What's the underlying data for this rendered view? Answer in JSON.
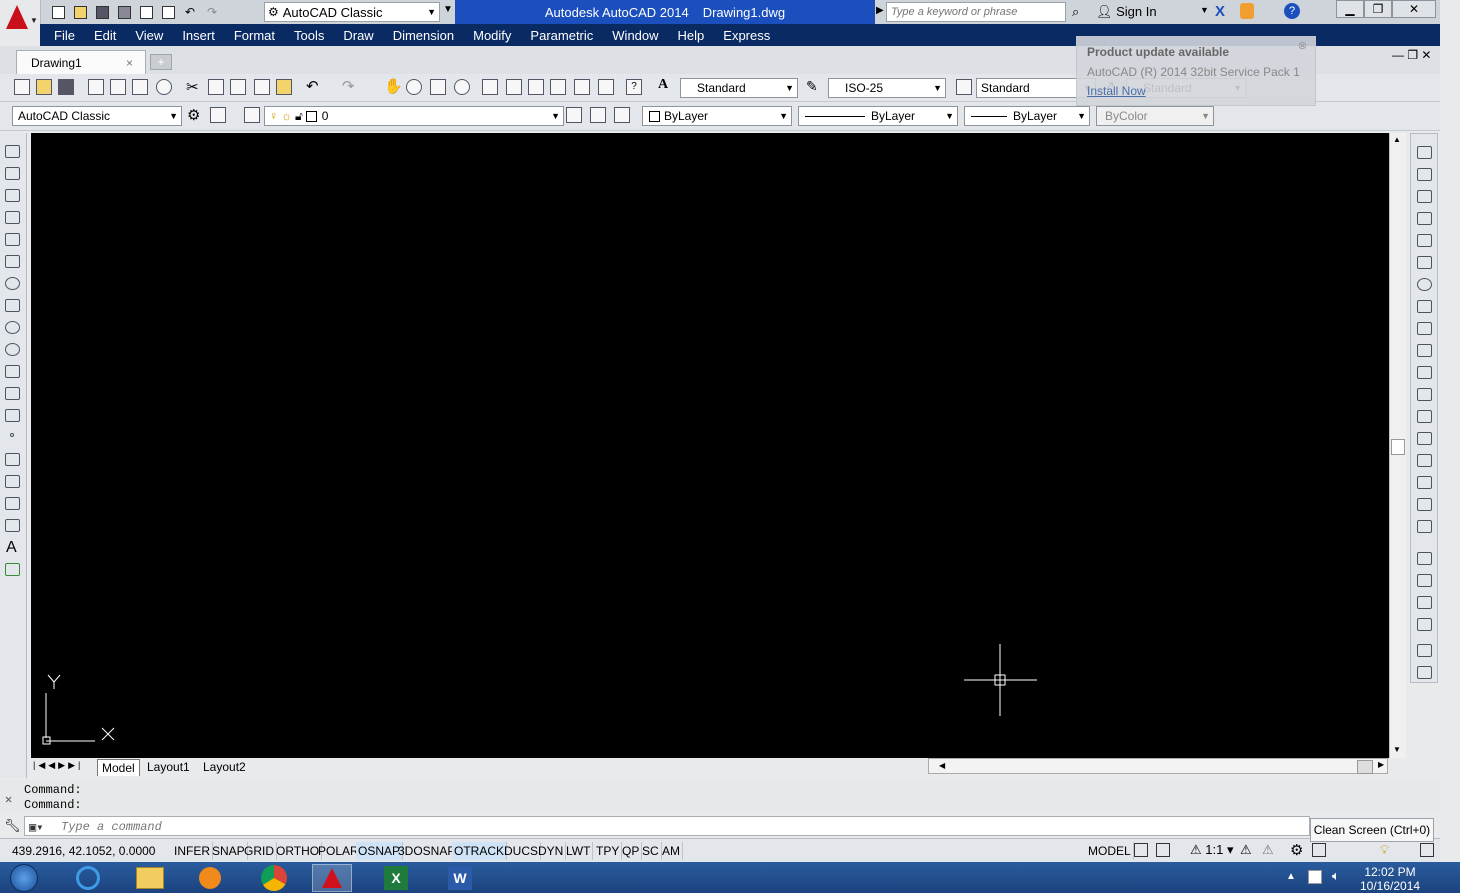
{
  "title_bar": {
    "workspace": "AutoCAD Classic",
    "app_name": "Autodesk AutoCAD 2014",
    "file_name": "Drawing1.dwg",
    "search_placeholder": "Type a keyword or phrase",
    "sign_in": "Sign In"
  },
  "menu": [
    "File",
    "Edit",
    "View",
    "Insert",
    "Format",
    "Tools",
    "Draw",
    "Dimension",
    "Modify",
    "Parametric",
    "Window",
    "Help",
    "Express"
  ],
  "doc_tab": {
    "label": "Drawing1",
    "close": "×"
  },
  "notification": {
    "title": "Product update available",
    "body": "AutoCAD (R) 2014 32bit Service Pack 1",
    "link": "Install Now"
  },
  "styles_toolbar": {
    "text_style": "Standard",
    "dim_style": "ISO-25",
    "table_style": "Standard",
    "multileader_style": "Standard"
  },
  "layers_toolbar": {
    "workspace": "AutoCAD Classic",
    "layer": "0",
    "color": "ByLayer",
    "linetype": "ByLayer",
    "lineweight": "ByLayer",
    "plot_style": "ByColor"
  },
  "ucs": {
    "x_label": "X",
    "y_label": "Y"
  },
  "layout_tabs": [
    "Model",
    "Layout1",
    "Layout2"
  ],
  "command": {
    "history": [
      "Command:",
      "Command:"
    ],
    "placeholder": "Type a command"
  },
  "status": {
    "coords": "439.2916, 42.1052, 0.0000",
    "toggles": [
      {
        "label": "INFER",
        "on": false
      },
      {
        "label": "SNAP",
        "on": false
      },
      {
        "label": "GRID",
        "on": false
      },
      {
        "label": "ORTHO",
        "on": false
      },
      {
        "label": "POLAR",
        "on": false
      },
      {
        "label": "OSNAP",
        "on": true
      },
      {
        "label": "3DOSNAP",
        "on": false
      },
      {
        "label": "OTRACK",
        "on": true
      },
      {
        "label": "DUCS",
        "on": false
      },
      {
        "label": "DYN",
        "on": false
      },
      {
        "label": "LWT",
        "on": false
      },
      {
        "label": "TPY",
        "on": false
      },
      {
        "label": "QP",
        "on": false
      },
      {
        "label": "SC",
        "on": false
      },
      {
        "label": "AM",
        "on": false
      }
    ],
    "model": "MODEL",
    "scale": "1:1"
  },
  "tooltip": "Clean Screen (Ctrl+0)",
  "taskbar": {
    "time": "12:02 PM",
    "date": "10/16/2014"
  }
}
